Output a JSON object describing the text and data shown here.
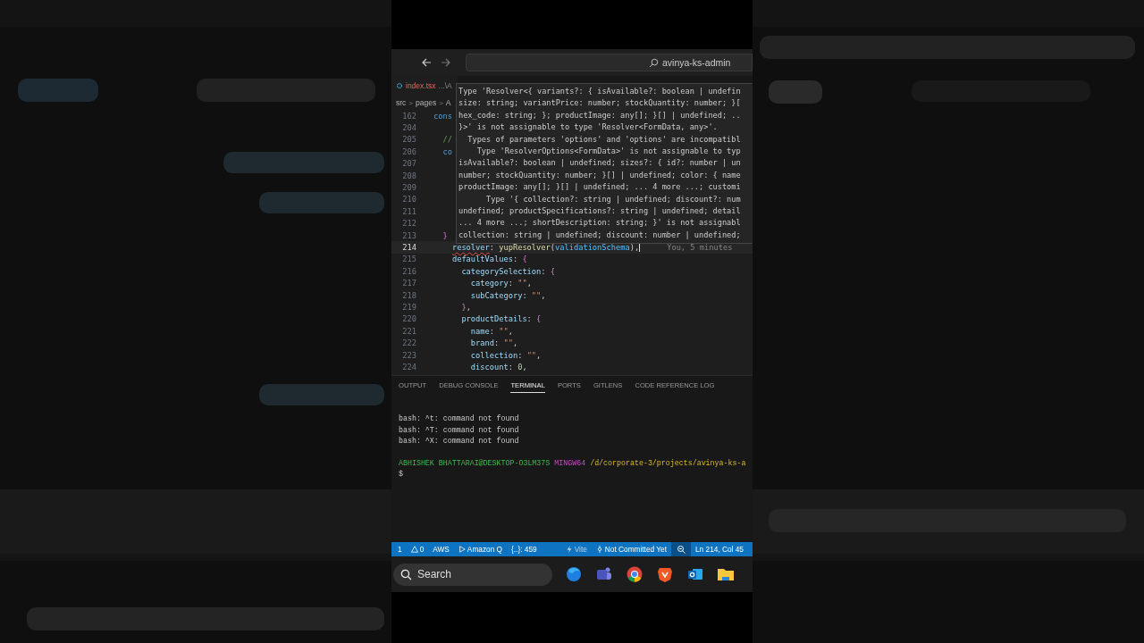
{
  "title_bar": {
    "search": "avinya-ks-admin"
  },
  "editor": {
    "tab": {
      "name": "index.tsx",
      "path": "...\\A"
    },
    "breadcrumb": [
      {
        "text": "src",
        "kind": "crumb"
      },
      {
        "text": ">",
        "kind": "separator"
      },
      {
        "text": "pages",
        "kind": "crumb"
      },
      {
        "text": ">",
        "kind": "separator"
      },
      {
        "text": "A",
        "kind": "crumb"
      }
    ],
    "lines": [
      {
        "number": "162",
        "current": false,
        "tokens": [
          {
            "text": "cons",
            "kind": "keyword"
          }
        ]
      },
      {
        "number": "204",
        "current": false
      },
      {
        "number": "205",
        "current": false,
        "tokens": [
          {
            "text": "  //",
            "kind": "comment"
          }
        ]
      },
      {
        "number": "206",
        "current": false,
        "tokens": [
          {
            "text": "  co",
            "kind": "keyword"
          }
        ]
      },
      {
        "number": "207",
        "current": false
      },
      {
        "number": "208",
        "current": false
      },
      {
        "number": "209",
        "current": false
      },
      {
        "number": "210",
        "current": false
      },
      {
        "number": "211",
        "current": false
      },
      {
        "number": "212",
        "current": false
      },
      {
        "number": "213",
        "current": false,
        "tokens": [
          {
            "text": "  }",
            "kind": "brace"
          }
        ]
      },
      {
        "number": "214",
        "current": true,
        "blame": "You, 5 minutes",
        "tokens": [
          {
            "text": "    resolver",
            "kind": "prop-error"
          },
          {
            "text": ": ",
            "kind": "punct"
          },
          {
            "text": "yupResolver",
            "kind": "fn"
          },
          {
            "text": "(",
            "kind": "punct"
          },
          {
            "text": "validationSchema",
            "kind": "var"
          },
          {
            "text": "),",
            "kind": "punct"
          }
        ]
      },
      {
        "number": "215",
        "current": false,
        "tokens": [
          {
            "text": "    defaultValues",
            "kind": "prop"
          },
          {
            "text": ": ",
            "kind": "punct"
          },
          {
            "text": "{",
            "kind": "brace"
          }
        ]
      },
      {
        "number": "216",
        "current": false,
        "tokens": [
          {
            "text": "      categorySelection",
            "kind": "prop"
          },
          {
            "text": ": ",
            "kind": "punct"
          },
          {
            "text": "{",
            "kind": "brace2"
          }
        ]
      },
      {
        "number": "217",
        "current": false,
        "tokens": [
          {
            "text": "        category",
            "kind": "prop"
          },
          {
            "text": ": ",
            "kind": "punct"
          },
          {
            "text": "\"\"",
            "kind": "str"
          },
          {
            "text": ",",
            "kind": "punct"
          }
        ]
      },
      {
        "number": "218",
        "current": false,
        "tokens": [
          {
            "text": "        subCategory",
            "kind": "prop"
          },
          {
            "text": ": ",
            "kind": "punct"
          },
          {
            "text": "\"\"",
            "kind": "str"
          },
          {
            "text": ",",
            "kind": "punct"
          }
        ]
      },
      {
        "number": "219",
        "current": false,
        "tokens": [
          {
            "text": "      }",
            "kind": "brace2"
          },
          {
            "text": ",",
            "kind": "punct"
          }
        ]
      },
      {
        "number": "220",
        "current": false,
        "tokens": [
          {
            "text": "      productDetails",
            "kind": "prop"
          },
          {
            "text": ": ",
            "kind": "punct"
          },
          {
            "text": "{",
            "kind": "brace2"
          }
        ]
      },
      {
        "number": "221",
        "current": false,
        "tokens": [
          {
            "text": "        name",
            "kind": "prop"
          },
          {
            "text": ": ",
            "kind": "punct"
          },
          {
            "text": "\"\"",
            "kind": "str"
          },
          {
            "text": ",",
            "kind": "punct"
          }
        ]
      },
      {
        "number": "222",
        "current": false,
        "tokens": [
          {
            "text": "        brand",
            "kind": "prop"
          },
          {
            "text": ": ",
            "kind": "punct"
          },
          {
            "text": "\"\"",
            "kind": "str"
          },
          {
            "text": ",",
            "kind": "punct"
          }
        ]
      },
      {
        "number": "223",
        "current": false,
        "tokens": [
          {
            "text": "        collection",
            "kind": "prop"
          },
          {
            "text": ": ",
            "kind": "punct"
          },
          {
            "text": "\"\"",
            "kind": "str"
          },
          {
            "text": ",",
            "kind": "punct"
          }
        ]
      },
      {
        "number": "224",
        "current": false,
        "tokens": [
          {
            "text": "        discount",
            "kind": "prop"
          },
          {
            "text": ": ",
            "kind": "punct"
          },
          {
            "text": "0",
            "kind": "num"
          },
          {
            "text": ",",
            "kind": "punct"
          }
        ]
      }
    ],
    "tooltip": [
      "Type 'Resolver<{ variants?: { isAvailable?: boolean | undefin",
      "size: string; variantPrice: number; stockQuantity: number; }[",
      "hex_code: string; }; productImage: any[]; }[] | undefined; ..",
      "}>' is not assignable to type 'Resolver<FormData, any>'.",
      "  Types of parameters 'options' and 'options' are incompatibl",
      "    Type 'ResolverOptions<FormData>' is not assignable to typ",
      "isAvailable?: boolean | undefined; sizes?: { id?: number | un",
      "number; stockQuantity: number; }[] | undefined; color: { name",
      "productImage: any[]; }[] | undefined; ... 4 more ...; customi",
      "      Type '{ collection?: string | undefined; discount?: num",
      "undefined; productSpecifications?: string | undefined; detail",
      "... 4 more ...; shortDescription: string; }' is not assignabl",
      "collection: string | undefined; discount: number | undefined;"
    ]
  },
  "panel": {
    "tabs": [
      {
        "label": "OUTPUT",
        "selected": false
      },
      {
        "label": "DEBUG CONSOLE",
        "selected": false
      },
      {
        "label": "TERMINAL",
        "selected": true
      },
      {
        "label": "PORTS",
        "selected": false
      },
      {
        "label": "GITLENS",
        "selected": false
      },
      {
        "label": "CODE REFERENCE LOG",
        "selected": false
      }
    ],
    "terminal": {
      "lines": [
        "bash: ^t: command not found",
        "bash: ^T: command not found",
        "bash: ^X: command not found"
      ],
      "prompt": {
        "user": "ABHISHEK BHATTARAI@DESKTOP-O3LM37S",
        "shell": "MINGW64",
        "path": "/d/corporate-3/projects/avinya-ks-a",
        "symbol": "$"
      }
    }
  },
  "status_bar": {
    "items": [
      {
        "kind": "errors",
        "text": "1"
      },
      {
        "kind": "warnings",
        "text": "0"
      },
      {
        "kind": "plain",
        "text": "AWS"
      },
      {
        "kind": "run",
        "text": "Amazon Q"
      },
      {
        "kind": "plain",
        "text": "{..}: 459"
      },
      {
        "kind": "vite",
        "text": "Vite"
      },
      {
        "kind": "commit",
        "text": "Not Committed Yet"
      }
    ],
    "position": "Ln 214, Col 45"
  },
  "taskbar": {
    "search": {
      "placeholder": "Search"
    }
  }
}
